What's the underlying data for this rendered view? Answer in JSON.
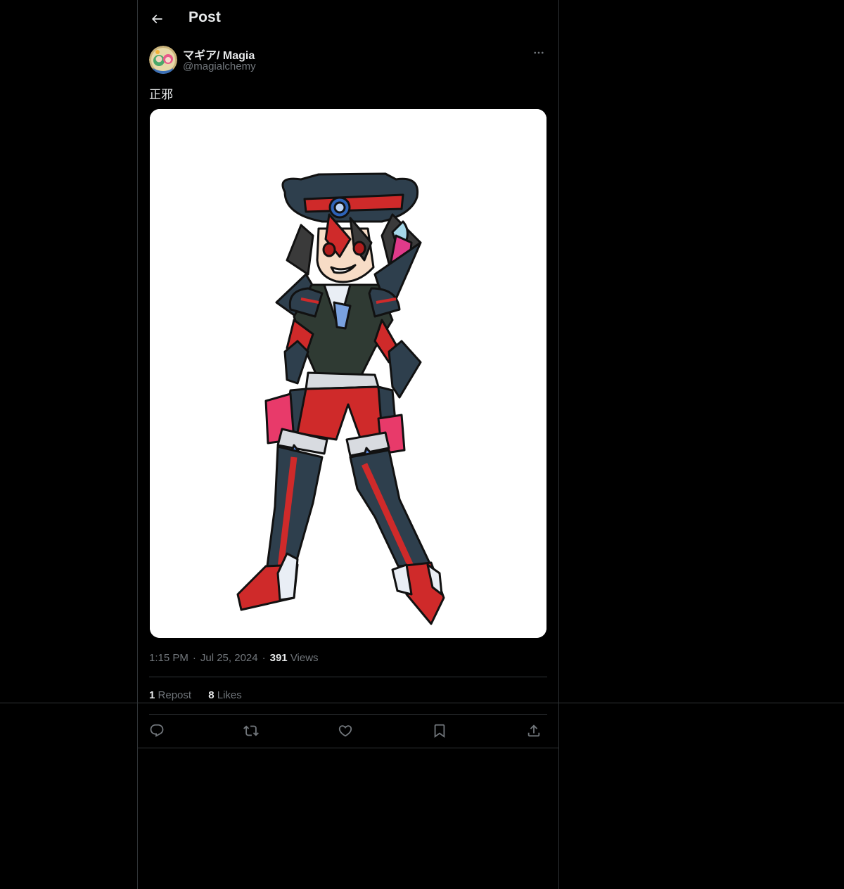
{
  "header": {
    "title": "Post",
    "back_icon": "arrow-left-icon"
  },
  "post": {
    "author": {
      "display_name": "マギア/ Magia",
      "handle": "@magialchemy",
      "avatar_icon": "avatar-image"
    },
    "text": "正邪",
    "media": {
      "description_icon": "illustration-image"
    },
    "time": "1:15 PM",
    "date": "Jul 25, 2024",
    "views_count": "391",
    "views_label": "Views",
    "reposts_count": "1",
    "reposts_label": "Repost",
    "likes_count": "8",
    "likes_label": "Likes"
  },
  "actions": [
    {
      "name": "reply",
      "icon": "reply-icon"
    },
    {
      "name": "repost",
      "icon": "repost-icon"
    },
    {
      "name": "like",
      "icon": "heart-icon"
    },
    {
      "name": "bookmark",
      "icon": "bookmark-icon"
    },
    {
      "name": "share",
      "icon": "share-icon"
    }
  ],
  "colors": {
    "background": "#000000",
    "border": "#2f3336",
    "text_primary": "#e7e9ea",
    "text_secondary": "#71767b"
  }
}
